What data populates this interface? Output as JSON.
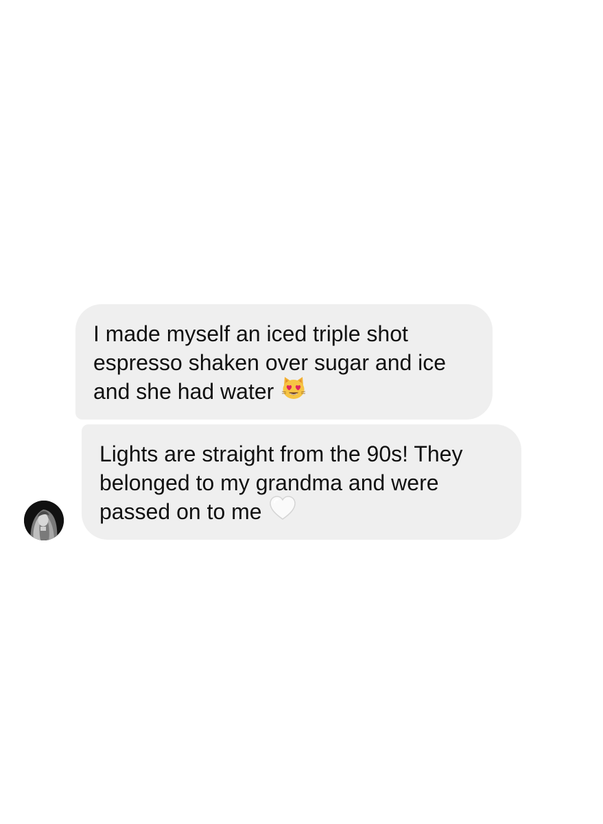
{
  "conversation": {
    "messages": [
      {
        "lines": [
          "I made myself an iced triple shot",
          "espresso shaken over sugar and ice",
          "and she had water"
        ],
        "emoji": "smiling-cat-heart-eyes"
      },
      {
        "lines": [
          "Lights are straight from the 90s! They",
          "belonged to my grandma and were",
          "passed on to me"
        ],
        "emoji": "white-heart"
      }
    ],
    "colors": {
      "background": "#ffffff",
      "bubble": "#efefef",
      "text": "#111111"
    }
  }
}
